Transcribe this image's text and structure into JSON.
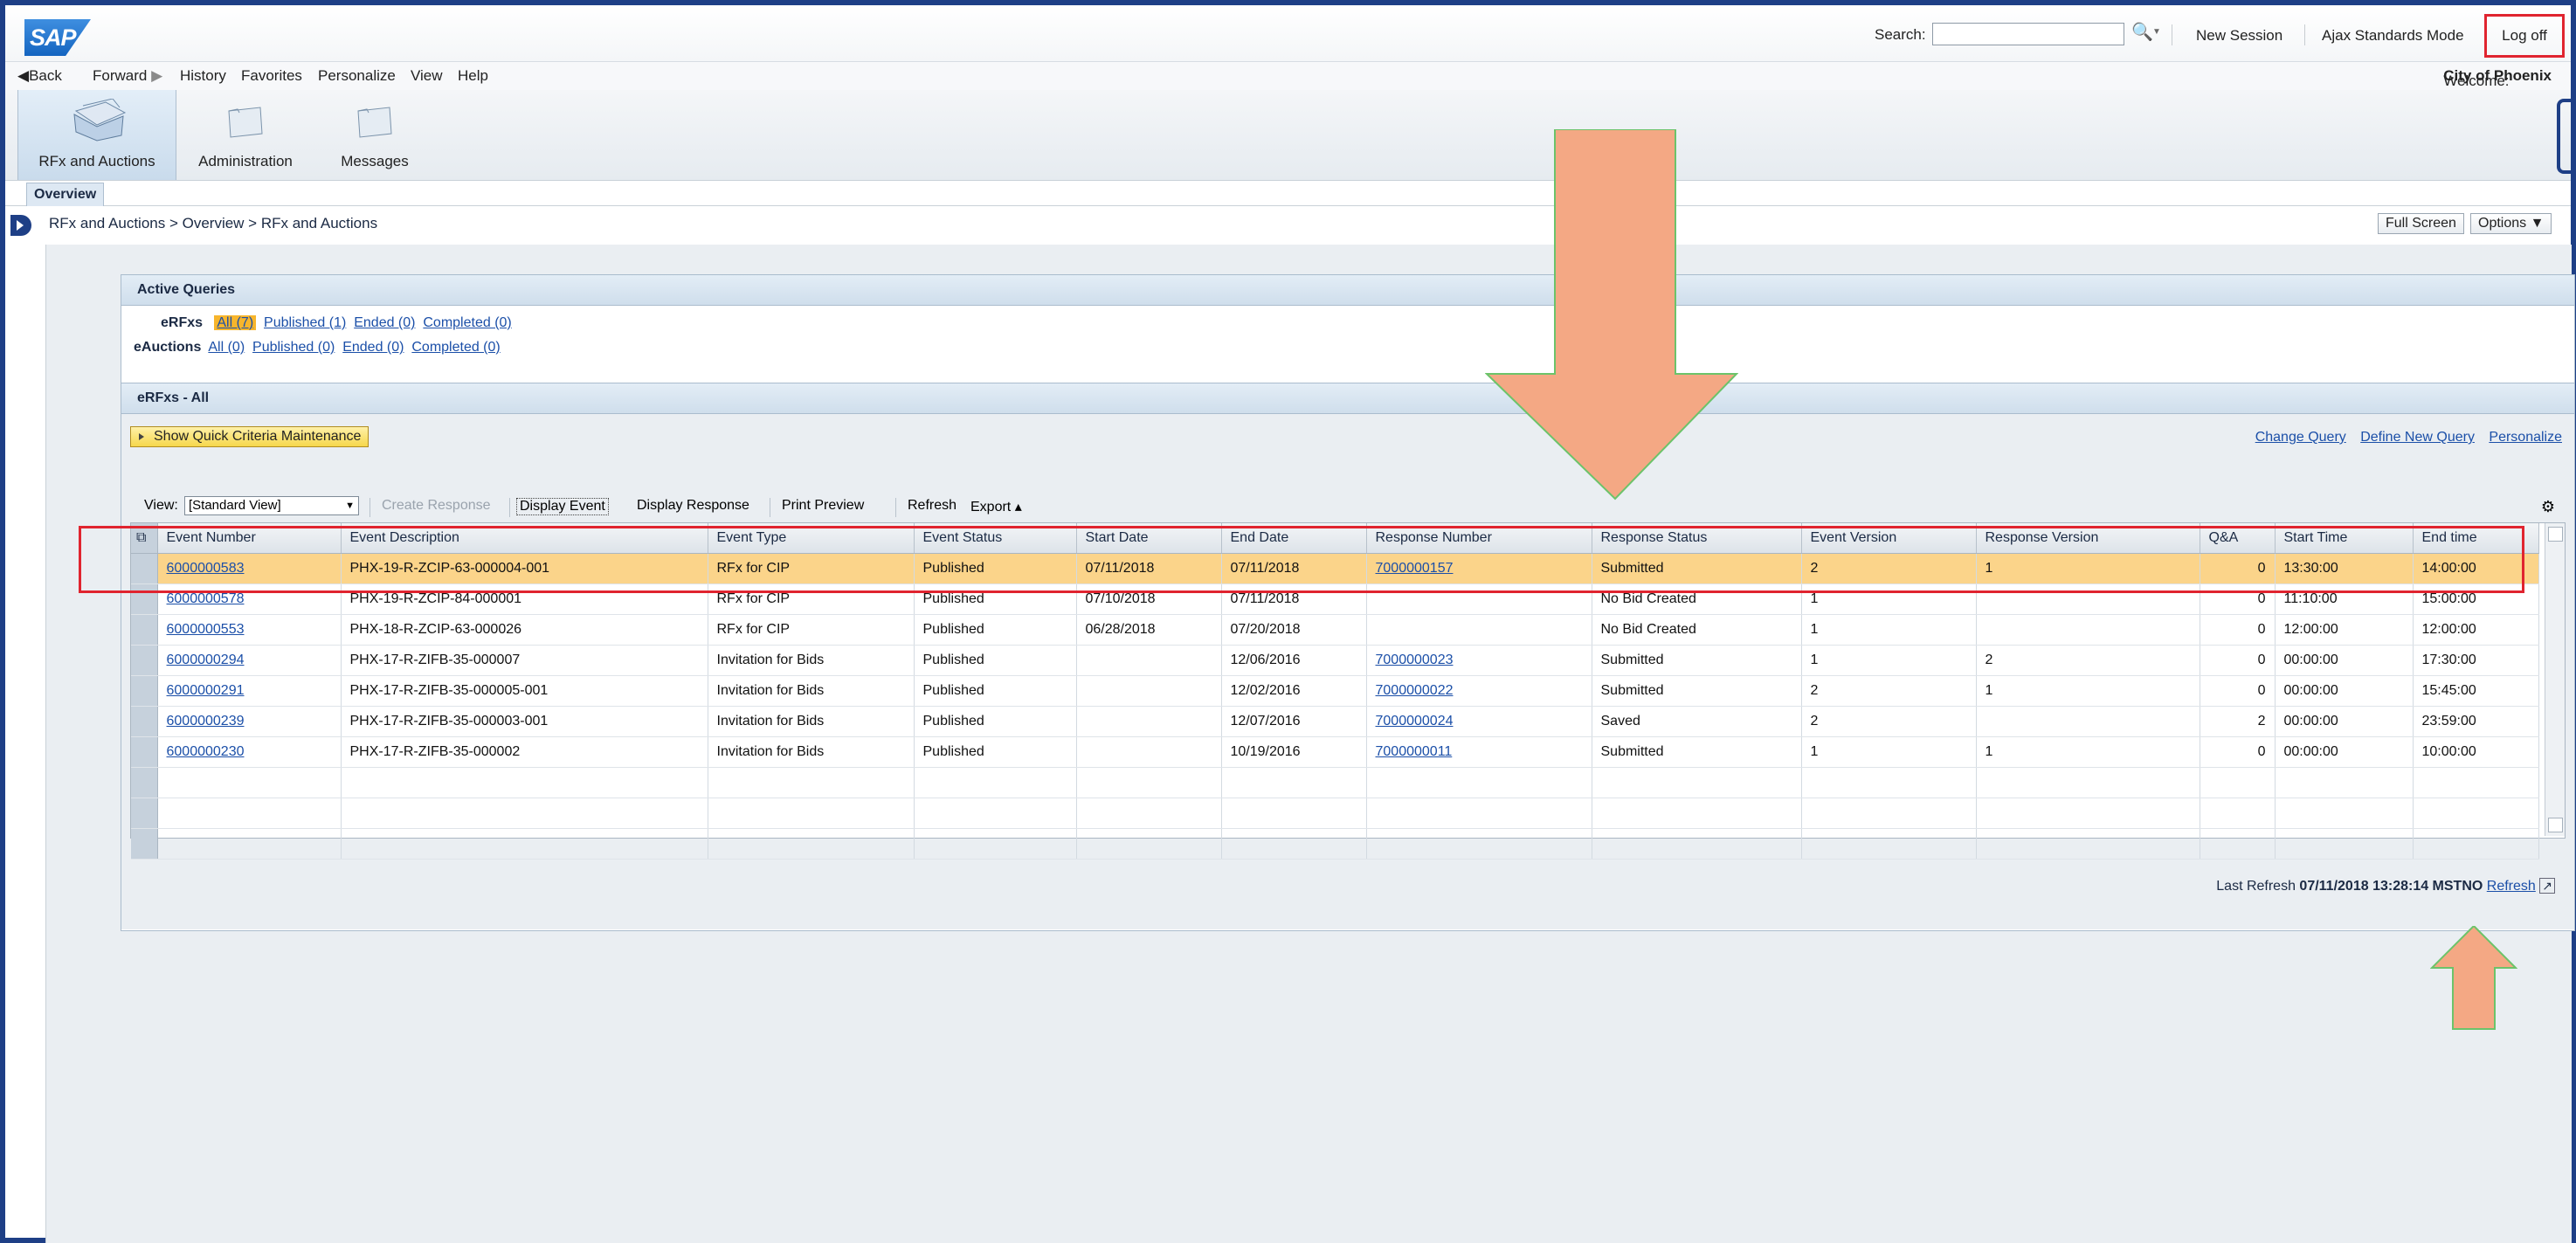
{
  "header": {
    "logo_text": "SAP",
    "search_label": "Search:",
    "search_placeholder": "",
    "new_session": "New Session",
    "ajax_mode": "Ajax Standards Mode",
    "log_off": "Log off"
  },
  "menu": {
    "back": "Back",
    "forward": "Forward",
    "history": "History",
    "favorites": "Favorites",
    "personalize": "Personalize",
    "view": "View",
    "help": "Help",
    "welcome_prefix": "Welcome: ",
    "welcome_name": "City of Phoenix"
  },
  "tabs": [
    {
      "label": "RFx and Auctions"
    },
    {
      "label": "Administration"
    },
    {
      "label": "Messages"
    }
  ],
  "subnav": {
    "overview": "Overview"
  },
  "breadcrumb": {
    "text": "RFx and Auctions  >  Overview  >  RFx and Auctions"
  },
  "page_buttons": {
    "full_screen": "Full Screen",
    "options": "Options ▼"
  },
  "active_queries": {
    "title": "Active Queries",
    "erfxs_label": "eRFxs",
    "erfxs_all": "All (7)",
    "erfxs_published": "Published (1)",
    "erfxs_ended": "Ended (0)",
    "erfxs_completed": "Completed (0)",
    "eauctions_label": "eAuctions",
    "eauctions_all": "All (0)",
    "eauctions_published": "Published (0)",
    "eauctions_ended": "Ended (0)",
    "eauctions_completed": "Completed (0)"
  },
  "erfx": {
    "title": "eRFxs - All",
    "quick_criteria": "Show Quick Criteria Maintenance",
    "change_query": "Change Query",
    "define_new_query": "Define New Query",
    "personalize": "Personalize",
    "view_label": "View:",
    "view_value": "[Standard View]",
    "create_response": "Create Response",
    "display_event": "Display Event",
    "display_response": "Display Response",
    "print_preview": "Print Preview",
    "refresh": "Refresh",
    "export": "Export ▴"
  },
  "table": {
    "columns": [
      "Event Number",
      "Event Description",
      "Event Type",
      "Event Status",
      "Start Date",
      "End Date",
      "Response Number",
      "Response Status",
      "Event Version",
      "Response Version",
      "Q&A",
      "Start Time",
      "End time"
    ],
    "rows": [
      [
        "6000000583",
        "PHX-19-R-ZCIP-63-000004-001",
        "RFx for CIP",
        "Published",
        "07/11/2018",
        "07/11/2018",
        "7000000157",
        "Submitted",
        "2",
        "1",
        "0",
        "13:30:00",
        "14:00:00"
      ],
      [
        "6000000578",
        "PHX-19-R-ZCIP-84-000001",
        "RFx for CIP",
        "Published",
        "07/10/2018",
        "07/11/2018",
        "",
        "No Bid Created",
        "1",
        "",
        "0",
        "11:10:00",
        "15:00:00"
      ],
      [
        "6000000553",
        "PHX-18-R-ZCIP-63-000026",
        "RFx for CIP",
        "Published",
        "06/28/2018",
        "07/20/2018",
        "",
        "No Bid Created",
        "1",
        "",
        "0",
        "12:00:00",
        "12:00:00"
      ],
      [
        "6000000294",
        "PHX-17-R-ZIFB-35-000007",
        "Invitation for Bids",
        "Published",
        "",
        "12/06/2016",
        "7000000023",
        "Submitted",
        "1",
        "2",
        "0",
        "00:00:00",
        "17:30:00"
      ],
      [
        "6000000291",
        "PHX-17-R-ZIFB-35-000005-001",
        "Invitation for Bids",
        "Published",
        "",
        "12/02/2016",
        "7000000022",
        "Submitted",
        "2",
        "1",
        "0",
        "00:00:00",
        "15:45:00"
      ],
      [
        "6000000239",
        "PHX-17-R-ZIFB-35-000003-001",
        "Invitation for Bids",
        "Published",
        "",
        "12/07/2016",
        "7000000024",
        "Saved",
        "2",
        "",
        "2",
        "00:00:00",
        "23:59:00"
      ],
      [
        "6000000230",
        "PHX-17-R-ZIFB-35-000002",
        "Invitation for Bids",
        "Published",
        "",
        "10/19/2016",
        "7000000011",
        "Submitted",
        "1",
        "1",
        "0",
        "00:00:00",
        "10:00:00"
      ]
    ]
  },
  "last_refresh": {
    "prefix": "Last Refresh ",
    "value": "07/11/2018 13:28:14 MSTNO",
    "link": "Refresh"
  },
  "colors": {
    "highlight_row": "#fbd48a",
    "annotation_red": "#e0242f",
    "arrow_fill": "#f4a884"
  }
}
